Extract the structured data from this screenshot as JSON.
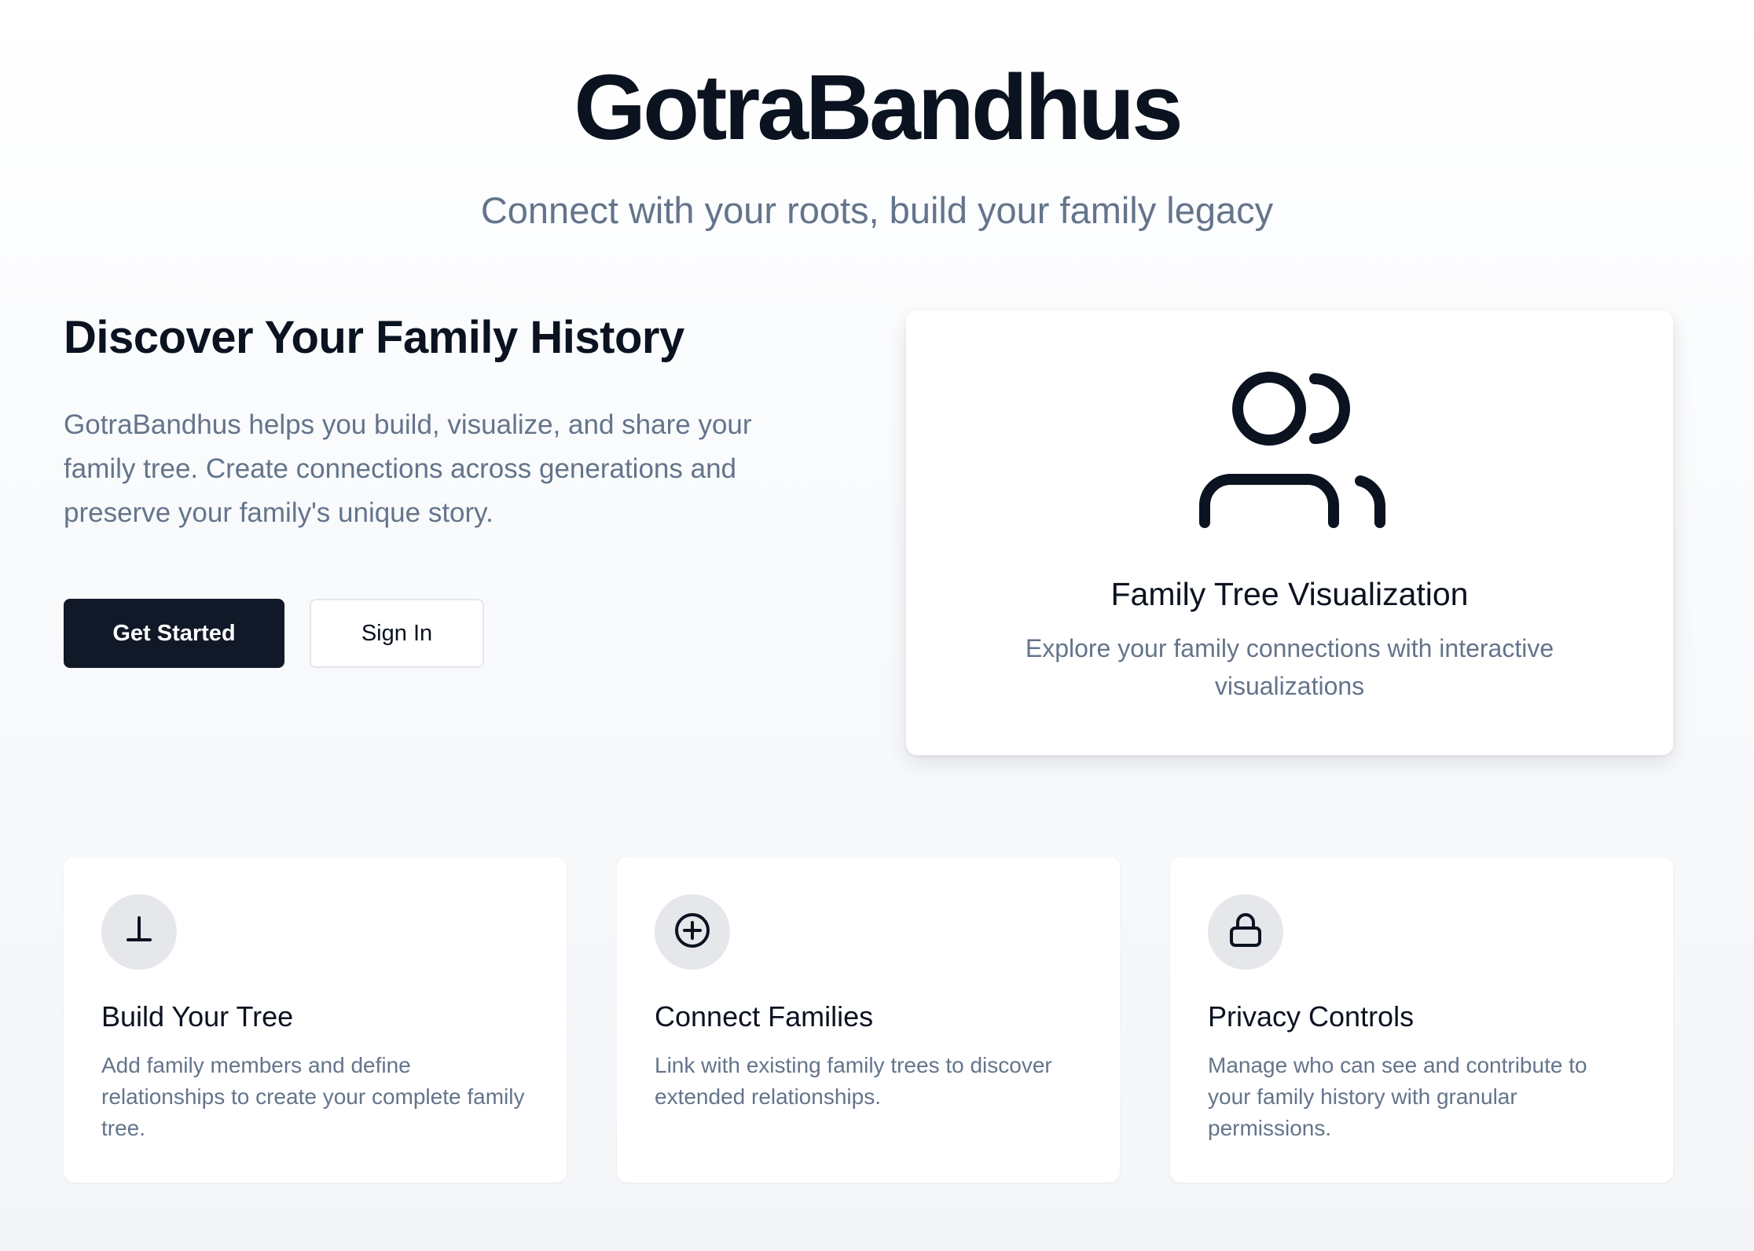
{
  "header": {
    "brand": "GotraBandhus",
    "tagline": "Connect with your roots, build your family legacy"
  },
  "hero": {
    "title": "Discover Your Family History",
    "description": "GotraBandhus helps you build, visualize, and share your family tree. Create connections across generations and preserve your family's unique story.",
    "primary_button": "Get Started",
    "secondary_button": "Sign In"
  },
  "visualization_card": {
    "icon": "users-icon",
    "title": "Family Tree Visualization",
    "description": "Explore your family connections with interactive visualizations"
  },
  "features": [
    {
      "icon": "perpendicular-icon",
      "title": "Build Your Tree",
      "description": "Add family members and define relationships to create your complete family tree."
    },
    {
      "icon": "plus-circle-icon",
      "title": "Connect Families",
      "description": "Link with existing family trees to discover extended relationships."
    },
    {
      "icon": "lock-icon",
      "title": "Privacy Controls",
      "description": "Manage who can see and contribute to your family history with granular permissions."
    }
  ],
  "colors": {
    "primary": "#111827",
    "text_dark": "#0b1220",
    "text_muted": "#64748b",
    "icon_bg": "#e5e7eb"
  }
}
